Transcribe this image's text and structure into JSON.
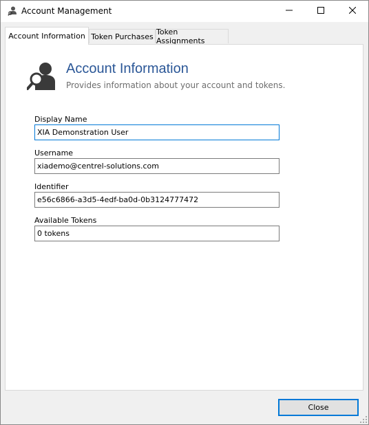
{
  "window": {
    "title": "Account Management",
    "icon": "account-user-icon",
    "controls": [
      "minimize-icon",
      "maximize-icon",
      "close-icon"
    ]
  },
  "tabs": [
    {
      "label": "Account Information",
      "active": true
    },
    {
      "label": "Token Purchases",
      "active": false
    },
    {
      "label": "Token Assignments",
      "active": false
    }
  ],
  "header": {
    "icon": "user-search-icon",
    "title": "Account Information",
    "subtitle": "Provides information about your account and tokens."
  },
  "fields": {
    "display_name": {
      "label": "Display Name",
      "value": "XIA Demonstration User"
    },
    "username": {
      "label": "Username",
      "value": "xiademo@centrel-solutions.com"
    },
    "identifier": {
      "label": "Identifier",
      "value": "e56c6866-a3d5-4edf-ba0d-0b3124777472"
    },
    "available_tokens": {
      "label": "Available Tokens",
      "value": "0 tokens"
    }
  },
  "footer": {
    "close_label": "Close"
  },
  "colors": {
    "accent": "#0078d7",
    "title_blue": "#2b5797",
    "subtitle_gray": "#6d6d6d"
  }
}
